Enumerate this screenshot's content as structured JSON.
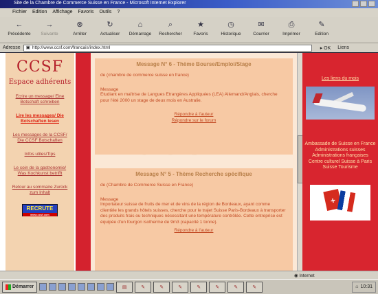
{
  "window": {
    "title": "Site de la Chambre de Commerce Suisse en France - Microsoft Internet Explorer"
  },
  "menu": [
    "Fichier",
    "Edition",
    "Affichage",
    "Favoris",
    "Outils",
    "?"
  ],
  "toolbar": [
    {
      "label": "Précédente",
      "icon": "back-arrow-icon",
      "glyph": "←",
      "dim": false
    },
    {
      "label": "Suivante",
      "icon": "forward-arrow-icon",
      "glyph": "→",
      "dim": true
    },
    {
      "label": "Arrêter",
      "icon": "stop-icon",
      "glyph": "⊗",
      "dim": false
    },
    {
      "label": "Actualiser",
      "icon": "refresh-icon",
      "glyph": "↻",
      "dim": false
    },
    {
      "label": "Démarrage",
      "icon": "home-icon",
      "glyph": "⌂",
      "dim": false
    },
    {
      "label": "Rechercher",
      "icon": "search-icon",
      "glyph": "⌕",
      "dim": false
    },
    {
      "label": "Favoris",
      "icon": "favorites-icon",
      "glyph": "★",
      "dim": false
    },
    {
      "label": "Historique",
      "icon": "history-icon",
      "glyph": "◷",
      "dim": false
    },
    {
      "label": "Courrier",
      "icon": "mail-icon",
      "glyph": "✉",
      "dim": false
    },
    {
      "label": "Imprimer",
      "icon": "print-icon",
      "glyph": "⎙",
      "dim": false
    },
    {
      "label": "Edition",
      "icon": "edit-icon",
      "glyph": "✎",
      "dim": false
    }
  ],
  "address": {
    "label": "Adresse",
    "value": "http://www.ccsf.com/francais/index.html",
    "go": "OK",
    "links": "Liens"
  },
  "sidebar": {
    "logo": "CCSF",
    "subtitle": "Espace adhérents",
    "links": [
      {
        "text": "Ecrire un message/ Eine Botschaft schreiben",
        "active": false
      },
      {
        "text": "Lire les messages/ Die Botschaften lesen",
        "active": true
      },
      {
        "text": "Les messages de la CCSF/ Die CCSF Botschaften",
        "active": false
      },
      {
        "text": "Infos utiles/Tips",
        "active": false
      },
      {
        "text": "Le coin de la gastronomie/ Was Kochkunst betrifft",
        "active": false
      },
      {
        "text": "Retour au sommaire Zurück zum Inhalt",
        "active": false
      }
    ],
    "badge": "RECRUTE",
    "badge_sub": "www.ccsf.com"
  },
  "main": {
    "watermark": "CCSF",
    "messages": [
      {
        "title": "Message N° 6 - Thème Bourse/Emploi/Stage",
        "from": "de (chambre de commerce suisse en france)",
        "label": "Message",
        "body": "Etudiant en maîtrise de Langues Etrangères Appliquées (LEA) Allemand/Anglais, cherche pour l'été 2000 un stage de deux mois en Australie.",
        "reply1": "Répondre à l'auteur",
        "reply2": "Répondre sur le forum"
      },
      {
        "title": "Message N° 5 - Thème Recherche spécifique",
        "from": "de (Chambre de Commerce Suisse en France)",
        "label": "Message",
        "body": "Importateur suisse de fruits de mer et de vins de la région de Bordeaux, ayant comme clientèle les grands hôtels suisses, cherche pour le trajet Suisse Paris-Bordeaux à transporter des produits frais ou techniques nécessitant une température contrôlée. Cette entreprise est équipée d'un fourgon isotherme de 9m3 (capacité 1 tonne).",
        "reply1": "Répondre à l'auteur"
      }
    ]
  },
  "rightpanel": {
    "title": "Les liens du mois",
    "links": [
      "Ambassade de Suisse en France",
      "Administrations suisses",
      "Administrations françaises",
      "Centre culturel Suisse à Paris",
      "Suisse Tourisme"
    ]
  },
  "status": {
    "zone": "Internet"
  },
  "taskbar": {
    "start": "Démarrer",
    "clock": "10:31"
  },
  "colors": {
    "accent_red": "#d4222e",
    "panel_peach": "#f7c9a4",
    "nav_bg": "#f3d3b0"
  }
}
